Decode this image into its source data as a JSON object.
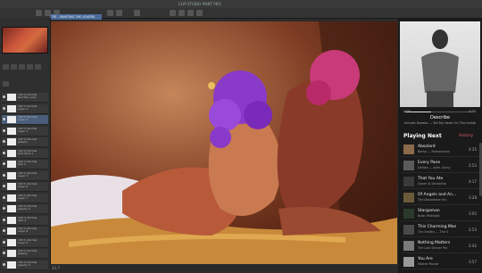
{
  "app": {
    "window_title": "CLIP STUDIO PAINT PRO",
    "canvas_tab": "TIE - PAINTING THE LOVERS"
  },
  "layers": [
    {
      "name": "100 % Normal",
      "sub": "Red fairy ellie"
    },
    {
      "name": "100 % Normal",
      "sub": "Layer 2"
    },
    {
      "name": "100 % Normal",
      "sub": "Layer 4"
    },
    {
      "name": "100 % Normal",
      "sub": "Layer 1"
    },
    {
      "name": "100 % Normal",
      "sub": "Jewelry"
    },
    {
      "name": "100 % Normal",
      "sub": "Pink Shirt 1"
    },
    {
      "name": "100 % Normal",
      "sub": "Hair 2"
    },
    {
      "name": "100 % Normal",
      "sub": "Layer 3"
    },
    {
      "name": "100 % Normal",
      "sub": "Layer 6"
    },
    {
      "name": "100 % Normal",
      "sub": "Layer 7"
    },
    {
      "name": "100 % Normal",
      "sub": "Jewelry 2"
    },
    {
      "name": "100 % Normal",
      "sub": "Skin 2"
    },
    {
      "name": "100 % Normal",
      "sub": "Layer 8"
    },
    {
      "name": "100 % Normal",
      "sub": "Layer 9"
    },
    {
      "name": "100 % Normal",
      "sub": "Jewelry"
    },
    {
      "name": "100 % Normal",
      "sub": "Jewelry 3"
    }
  ],
  "status": {
    "zoom": "33.7"
  },
  "player": {
    "progress": 0.38,
    "time_elapsed": "0:00",
    "time_remaining": "-4:30",
    "song_title": "Describe",
    "song_subtitle": "Infuriat Doreka — Tell My Heart On The Inside",
    "playing_next": "Playing Next",
    "history": "History",
    "tracks": [
      {
        "title": "Absolard",
        "artist": "Barho — Romantasm",
        "dur": "4:35",
        "color": "#8a6a4a"
      },
      {
        "title": "Every Pane",
        "artist": "Delilah — Adm. Shiny",
        "dur": "2:53",
        "color": "#5a5a5a"
      },
      {
        "title": "That You Ate",
        "artist": "Dozen & Dorbolino",
        "dur": "4:17",
        "color": "#3a3a3a"
      },
      {
        "title": "Of Angels and An...",
        "artist": "The Decorative Ins",
        "dur": "3:28",
        "color": "#6a5a3a"
      },
      {
        "title": "Stargaman",
        "artist": "Bular Midnight",
        "dur": "3:05",
        "color": "#2a3a2a"
      },
      {
        "title": "This Charming Man",
        "artist": "The Smiths — The S",
        "dur": "2:53",
        "color": "#4a4a4a"
      },
      {
        "title": "Nothing Matters",
        "artist": "The Last Dinner Par",
        "dur": "2:42",
        "color": "#7a7a7a"
      },
      {
        "title": "You Are",
        "artist": "Mother Rouse",
        "dur": "3:57",
        "color": "#9a9a9a"
      }
    ]
  }
}
